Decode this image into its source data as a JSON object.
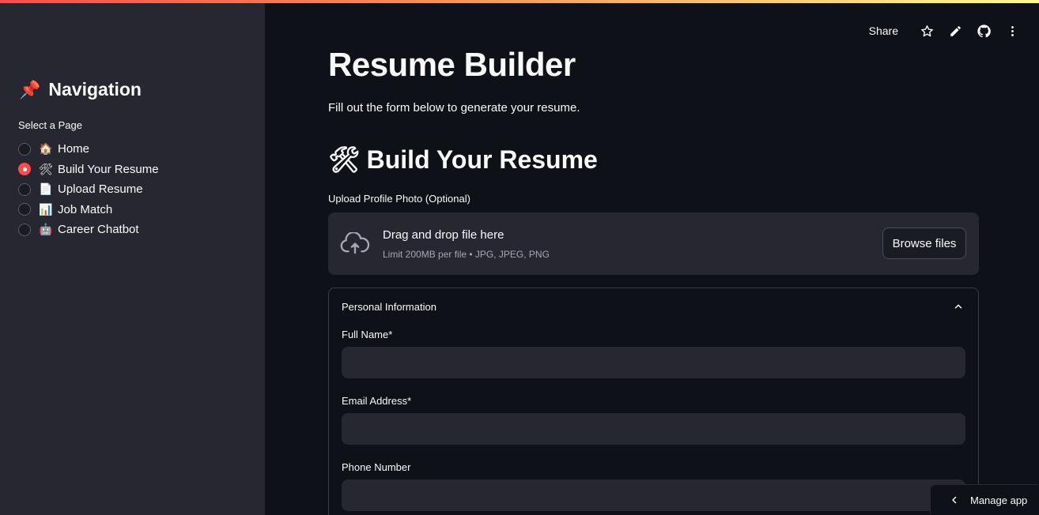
{
  "sidebar": {
    "title": "Navigation",
    "title_icon": "📌",
    "select_label": "Select a Page",
    "items": [
      {
        "emoji": "🏠",
        "label": "Home",
        "checked": false
      },
      {
        "emoji": "🛠",
        "label": "Build Your Resume",
        "checked": true
      },
      {
        "emoji": "📄",
        "label": "Upload Resume",
        "checked": false
      },
      {
        "emoji": "📊",
        "label": "Job Match",
        "checked": false
      },
      {
        "emoji": "🤖",
        "label": "Career Chatbot",
        "checked": false
      }
    ]
  },
  "toolbar": {
    "share_label": "Share",
    "icons": [
      "star-icon",
      "pencil-icon",
      "github-icon",
      "more-vertical-icon"
    ]
  },
  "main": {
    "title": "Resume Builder",
    "subtitle": "Fill out the form below to generate your resume.",
    "section_title": "Build Your Resume",
    "section_icon": "🛠",
    "upload": {
      "label": "Upload Profile Photo (Optional)",
      "drop_title": "Drag and drop file here",
      "drop_sub": "Limit 200MB per file • JPG, JPEG, PNG",
      "browse_label": "Browse files"
    },
    "expander": {
      "title": "Personal Information",
      "fields": [
        {
          "label": "Full Name*",
          "value": ""
        },
        {
          "label": "Email Address*",
          "value": ""
        },
        {
          "label": "Phone Number",
          "value": ""
        }
      ]
    }
  },
  "footer": {
    "manage_label": "Manage app"
  },
  "colors": {
    "accent": "#ff4b4b",
    "background": "#0e1117",
    "sidebar": "#262730"
  }
}
